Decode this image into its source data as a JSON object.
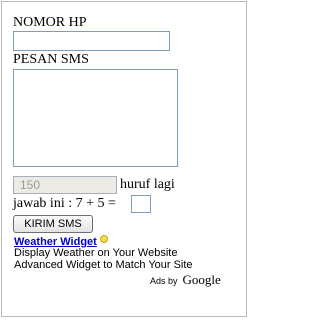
{
  "form": {
    "phone_label": "NOMOR HP",
    "phone_value": "",
    "message_label": "PESAN SMS",
    "message_value": "",
    "char_counter": "150",
    "char_counter_suffix": "huruf lagi",
    "captcha_question": "jawab ini : 7 + 5 =",
    "captcha_answer": "",
    "send_label": "KIRIM SMS"
  },
  "ad": {
    "title": "Weather Widget",
    "title_icon": "lightbulb-icon",
    "line1": "Display Weather on Your Website",
    "line2": "Advanced Widget to Match Your Site",
    "ads_by_label": "Ads by",
    "google_label": "Google"
  },
  "colors": {
    "ad_title": "#0000cc",
    "input_border": "#7f9db9",
    "disabled_field_bg": "#ebebe4"
  }
}
